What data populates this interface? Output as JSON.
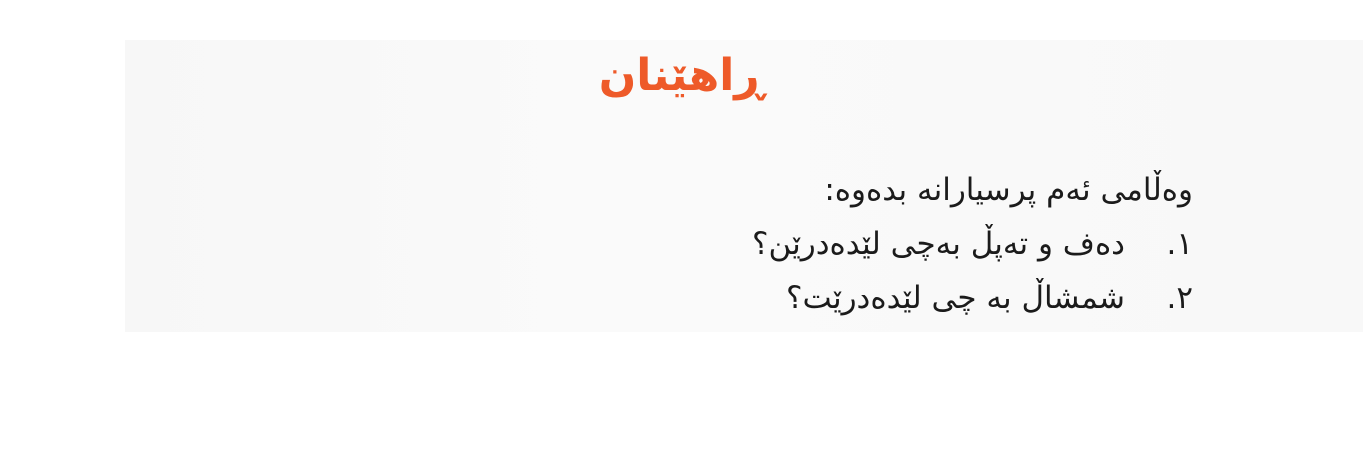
{
  "exercise": {
    "title": "ڕاهێنان",
    "instruction": "وەڵامی ئەم پرسیارانە بدەوە:",
    "questions": [
      {
        "number": "١.",
        "text": "دەف و تەپڵ بەچی لێدەدرێن؟"
      },
      {
        "number": "٢.",
        "text": "شمشاڵ بە چی لێدەدرێت؟"
      }
    ]
  },
  "colors": {
    "title": "#ee5a29",
    "text": "#1b1b1b",
    "panel": "#f8f8f8"
  }
}
